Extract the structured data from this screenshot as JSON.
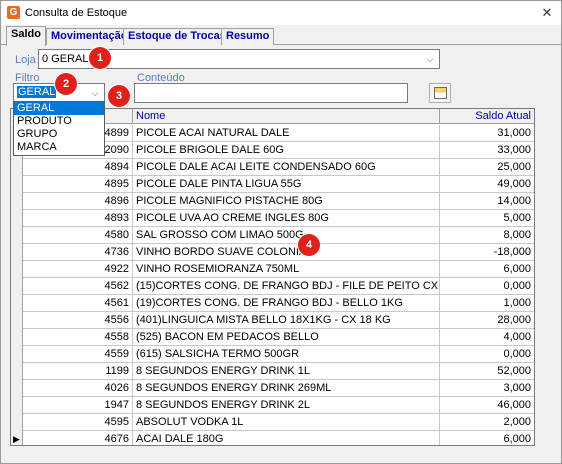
{
  "window": {
    "title": "Consulta de Estoque",
    "app_icon": "G",
    "close": "✕"
  },
  "tabs": [
    {
      "label": "Saldo",
      "active": true
    },
    {
      "label": "Movimentação",
      "active": false
    },
    {
      "label": "Estoque de Trocas",
      "active": false
    },
    {
      "label": "Resumo",
      "active": false
    }
  ],
  "form": {
    "loja_label": "Loja",
    "loja_value": "0 GERAL",
    "filtro_label": "Filtro",
    "filtro_value": "GERAL",
    "conteudo_label": "Conteúdo",
    "conteudo_value": ""
  },
  "filtro_options": [
    "GERAL",
    "PRODUTO",
    "GRUPO",
    "MARCA"
  ],
  "badges": [
    "1",
    "2",
    "3",
    "4"
  ],
  "grid": {
    "headers": {
      "nome": "Nome",
      "saldo": "Saldo Atual"
    },
    "rows": [
      {
        "cod": "4899",
        "nome": "PICOLE ACAI NATURAL DALE",
        "saldo": "31,000"
      },
      {
        "cod": "2090",
        "nome": "PICOLE BRIGOLE DALE 60G",
        "saldo": "33,000"
      },
      {
        "cod": "4894",
        "nome": "PICOLE DALE ACAI LEITE CONDENSADO 60G",
        "saldo": "25,000"
      },
      {
        "cod": "4895",
        "nome": "PICOLE DALE PINTA LIGUA 55G",
        "saldo": "49,000"
      },
      {
        "cod": "4896",
        "nome": "PICOLE MAGNIFICO PISTACHE 80G",
        "saldo": "14,000"
      },
      {
        "cod": "4893",
        "nome": "PICOLE UVA AO CREME INGLES 80G",
        "saldo": "5,000"
      },
      {
        "cod": "4580",
        "nome": "SAL GROSSO COM LIMAO 500G",
        "saldo": "8,000"
      },
      {
        "cod": "4736",
        "nome": "VINHO BORDO SUAVE COLONIAL",
        "saldo": "-18,000"
      },
      {
        "cod": "4922",
        "nome": "VINHO ROSEMIORANZA 750ML",
        "saldo": "6,000"
      },
      {
        "cod": "4562",
        "nome": "(15)CORTES CONG. DE FRANGO BDJ - FILE DE PEITO CX 12 I",
        "saldo": "0,000"
      },
      {
        "cod": "4561",
        "nome": "(19)CORTES CONG. DE FRANGO BDJ - BELLO 1KG",
        "saldo": "1,000"
      },
      {
        "cod": "4556",
        "nome": "(401)LINGUICA MISTA BELLO 18X1KG - CX 18 KG",
        "saldo": "28,000"
      },
      {
        "cod": "4558",
        "nome": "(525) BACON EM PEDACOS BELLO",
        "saldo": "4,000"
      },
      {
        "cod": "4559",
        "nome": "(615) SALSICHA TERMO 500GR",
        "saldo": "0,000"
      },
      {
        "cod": "1199",
        "nome": "8 SEGUNDOS ENERGY DRINK 1L",
        "saldo": "52,000"
      },
      {
        "cod": "4026",
        "nome": "8 SEGUNDOS ENERGY DRINK 269ML",
        "saldo": "3,000"
      },
      {
        "cod": "1947",
        "nome": "8 SEGUNDOS ENERGY DRINK 2L",
        "saldo": "46,000"
      },
      {
        "cod": "4595",
        "nome": "ABSOLUT VODKA 1L",
        "saldo": "2,000"
      },
      {
        "cod": "4676",
        "nome": "ACAI DALE 180G",
        "saldo": "6,000"
      }
    ],
    "current_row_indicator": "▶"
  }
}
